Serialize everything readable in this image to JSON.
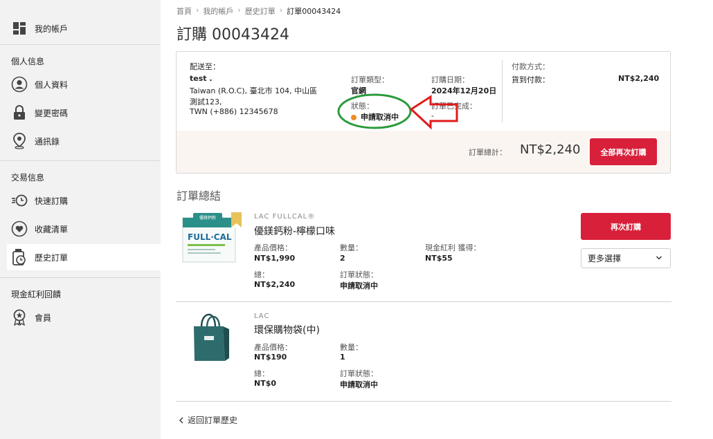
{
  "sidebar": {
    "account_label": "我的帳戶",
    "section_personal": "個人信息",
    "profile_label": "個人資料",
    "password_label": "變更密碼",
    "addressbook_label": "通訊錄",
    "section_trade": "交易信息",
    "quickorder_label": "快速訂購",
    "wishlist_label": "收藏清單",
    "history_label": "歷史訂單",
    "section_rewards": "現金紅利回饋",
    "member_label": "會員"
  },
  "breadcrumb": {
    "home": "首頁",
    "account": "我的帳戶",
    "history": "歷史訂單",
    "current": "訂單00043424",
    "sep": "›"
  },
  "order": {
    "title": "訂購 00043424",
    "ship_to_label": "配送至：",
    "ship_name": "test .",
    "ship_line1": "Taiwan (R.O.C), 臺北市 104, 中山區",
    "ship_line2": "測試123,",
    "ship_line3": "TWN (+886) 12345678",
    "type_label": "訂單類型：",
    "type_value": "官網",
    "status_label": "狀態：",
    "status_value": "申請取消中",
    "date_label": "訂購日期：",
    "date_value": "2024年12月20日",
    "completed_label": "訂單已完成：",
    "completed_value": "-",
    "payment_label": "付款方式：",
    "payment_method": "貨到付款：",
    "payment_amount": "NT$2,240",
    "total_label": "訂單總計：",
    "total_value": "NT$2,240",
    "reorder_all_label": "全部再次訂購"
  },
  "summary_title": "訂單總結",
  "products": [
    {
      "brand": "LAC FULLCAL®",
      "name": "優鎂鈣粉-檸檬口味",
      "price_label": "產品價格：",
      "price": "NT$1,990",
      "qty_label": "數量：",
      "qty": "2",
      "reward_label": "現金紅利 獲得：",
      "reward": "NT$55",
      "total_label": "總：",
      "total": "NT$2,240",
      "status_label": "訂單狀態：",
      "status": "申請取消中"
    },
    {
      "brand": "LAC",
      "name": "環保購物袋(中)",
      "price_label": "產品價格：",
      "price": "NT$190",
      "qty_label": "數量：",
      "qty": "1",
      "total_label": "總：",
      "total": "NT$0",
      "status_label": "訂單狀態：",
      "status": "申請取消中"
    }
  ],
  "actions": {
    "reorder_label": "再次訂購",
    "more_options_label": "更多選擇"
  },
  "back_label": "返回訂單歷史",
  "colors": {
    "accent": "#d8203a",
    "status_dot": "#f08a24",
    "annotation_circle": "#2a9a3a",
    "annotation_arrow": "#e01b1b"
  }
}
